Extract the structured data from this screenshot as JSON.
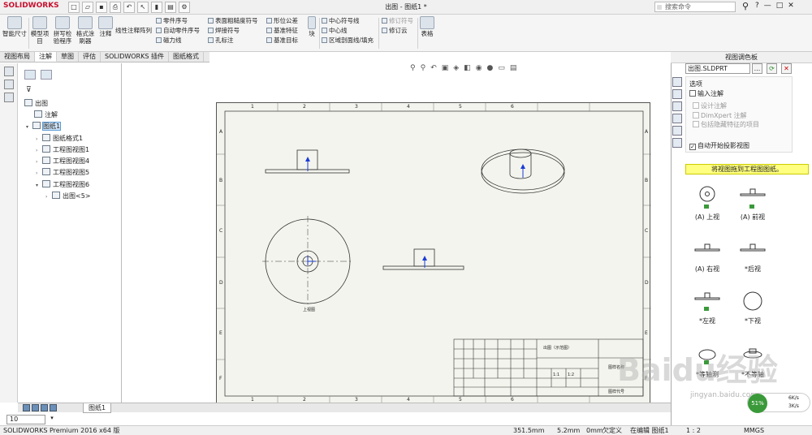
{
  "app": {
    "logo": "SOLIDWORKS",
    "title": "出图 - 图纸1 *",
    "search_placeholder": "搜索命令",
    "win_help": "?",
    "win_min": "—",
    "win_restore": "□",
    "win_close": "✕"
  },
  "ribbon": {
    "smart_dim": "智能尺寸",
    "model_items": "模型项目",
    "spell_check": "拼写检验程序",
    "format_painter": "格式涂刷器",
    "note": "注释",
    "linear_pattern": "线性注释阵列",
    "balloon": "零件序号",
    "auto_balloon": "自动零件序号",
    "magnetic_line": "磁力线",
    "surface_finish": "表面粗糙度符号",
    "weld_symbol": "焊接符号",
    "hole_callout": "孔标注",
    "geo_tol": "形位公差",
    "datum_feature": "基准特征",
    "datum_target": "基准目标",
    "block": "块",
    "center_mark": "中心符号线",
    "centerline": "中心线",
    "area_hatch": "区域剖面线/填充",
    "revision_symbol": "修订符号",
    "revision_cloud": "修订云",
    "table": "表格"
  },
  "tabs": [
    "视图布局",
    "注解",
    "草图",
    "评估",
    "SOLIDWORKS 插件",
    "图纸格式"
  ],
  "tree": {
    "root": "出图",
    "annotations": "注解",
    "sheet": "图纸1",
    "sheet_format": "图纸格式1",
    "view1": "工程图视图1",
    "view4": "工程图视图4",
    "view5": "工程图视图5",
    "view6": "工程图视图6",
    "child": "出图<5>"
  },
  "sheet": {
    "cols": [
      "1",
      "2",
      "3",
      "4",
      "5",
      "6"
    ],
    "rows": [
      "A",
      "B",
      "C",
      "D",
      "E",
      "F"
    ],
    "view_label": "上视图",
    "tb_name": "出图（示范图）",
    "tb_scale": "1:2",
    "tb_sheet": "1:1",
    "tb_title": "图样名称",
    "tb_code": "图样代号"
  },
  "sheet_tab": "图纸1",
  "zoom": "10",
  "status": {
    "product": "SOLIDWORKS Premium 2016 x64 版",
    "x": "351.5mm",
    "y": "5.2mm",
    "z": "0mm",
    "state": "欠定义",
    "editing": "在编辑 图纸1",
    "scale": "1 : 2",
    "units": "MMGS"
  },
  "palette": {
    "title": "视图调色板",
    "file": "出图.SLDPRT",
    "btn_more": "...",
    "btn_refresh": "⟳",
    "btn_close": "✕",
    "options_title": "选项",
    "import_annotations": "输入注解",
    "design_annotations": "设计注解",
    "dimxpert": "DimXpert 注解",
    "hidden_items": "包括隐藏特征的项目",
    "auto_projection": "自动开始投影视图",
    "hint": "将视图拖到工程图图纸。",
    "views": [
      {
        "label": "(A) 上视"
      },
      {
        "label": "(A) 前视"
      },
      {
        "label": "(A) 右视"
      },
      {
        "label": "*后视"
      },
      {
        "label": "*左视"
      },
      {
        "label": "*下视"
      },
      {
        "label": "*等轴测"
      },
      {
        "label": "*不等轴"
      }
    ]
  },
  "watermark": "Baidu经验",
  "watermark_url": "jingyan.baidu.com",
  "net": {
    "pct": "51%",
    "up": "6K/s",
    "down": "3K/s"
  }
}
